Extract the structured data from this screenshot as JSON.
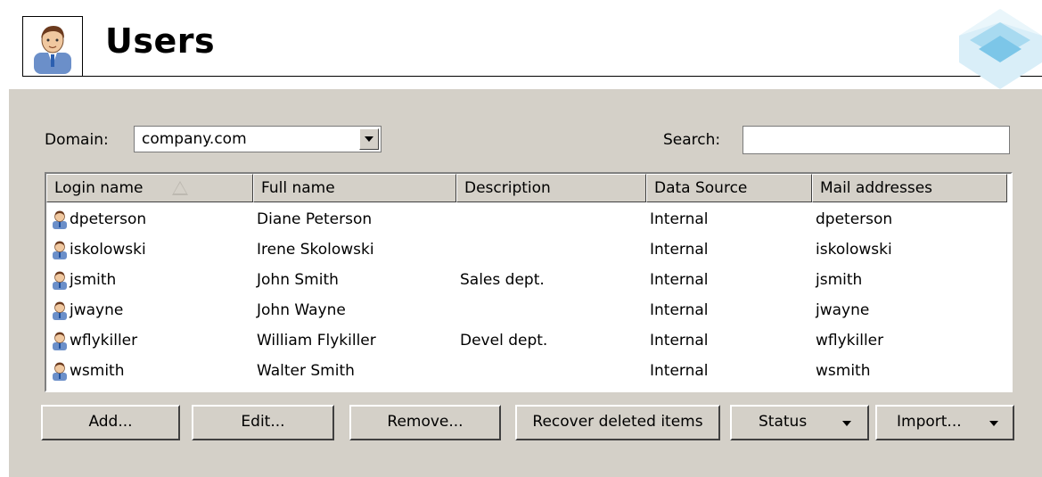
{
  "header": {
    "title": "Users"
  },
  "domain": {
    "label": "Domain:",
    "value": "company.com"
  },
  "search": {
    "label": "Search:",
    "value": ""
  },
  "table": {
    "columns": [
      "Login name",
      "Full name",
      "Description",
      "Data Source",
      "Mail addresses"
    ],
    "sorted_column": "Login name",
    "sort_direction": "ascending",
    "rows": [
      {
        "login": "dpeterson",
        "full_name": "Diane Peterson",
        "description": "",
        "source": "Internal",
        "mail": "dpeterson"
      },
      {
        "login": "iskolowski",
        "full_name": "Irene Skolowski",
        "description": "",
        "source": "Internal",
        "mail": "iskolowski"
      },
      {
        "login": "jsmith",
        "full_name": "John Smith",
        "description": "Sales dept.",
        "source": "Internal",
        "mail": "jsmith"
      },
      {
        "login": "jwayne",
        "full_name": "John Wayne",
        "description": "",
        "source": "Internal",
        "mail": "jwayne"
      },
      {
        "login": "wflykiller",
        "full_name": "William Flykiller",
        "description": "Devel dept.",
        "source": "Internal",
        "mail": "wflykiller"
      },
      {
        "login": "wsmith",
        "full_name": "Walter Smith",
        "description": "",
        "source": "Internal",
        "mail": "wsmith"
      }
    ]
  },
  "buttons": {
    "add": "Add...",
    "edit": "Edit...",
    "remove": "Remove...",
    "recover": "Recover deleted items",
    "status": "Status",
    "import": "Import..."
  },
  "colors": {
    "panel": "#d4d0c8",
    "logo_accent": "#9fd3ec"
  },
  "icons": {
    "header": "user-avatar-icon",
    "row": "user-icon",
    "logo": "product-logo-icon"
  }
}
